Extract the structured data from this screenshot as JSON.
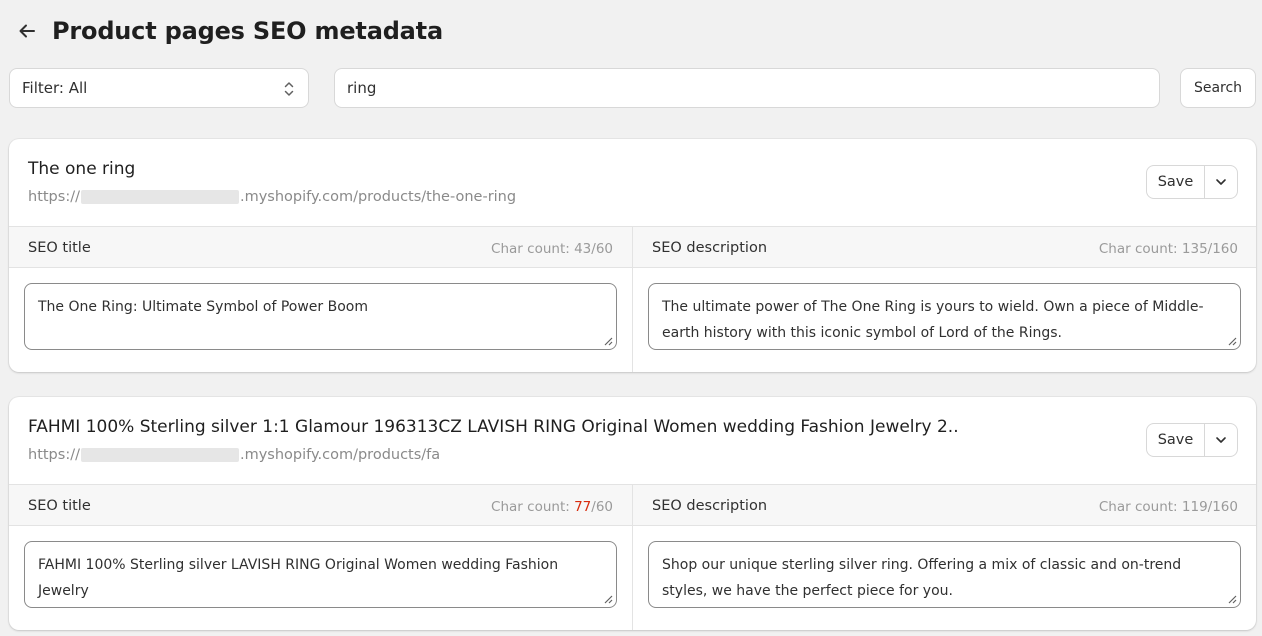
{
  "header": {
    "title": "Product pages SEO metadata",
    "back_icon": "arrow-left-icon"
  },
  "filter": {
    "label": "Filter: All"
  },
  "search": {
    "value": "ring",
    "button_label": "Search"
  },
  "products": [
    {
      "name": "The one ring",
      "url_prefix": "https://",
      "url_suffix": ".myshopify.com/products/the-one-ring",
      "save_label": "Save",
      "seo_title_label": "SEO title",
      "seo_title_count_prefix": "Char count: ",
      "seo_title_count": "43",
      "seo_title_max": "/60",
      "seo_title_value": "The One Ring: Ultimate Symbol of Power Boom",
      "seo_description_label": "SEO description",
      "seo_description_count_prefix": "Char count: ",
      "seo_description_count": "135",
      "seo_description_max": "/160",
      "seo_description_value": "The ultimate power of The One Ring is yours to wield. Own a piece of Middle-earth history with this iconic symbol of Lord of the Rings."
    },
    {
      "name": "FAHMI 100% Sterling silver 1:1 Glamour 196313CZ LAVISH RING Original Women wedding Fashion Jewelry 2..",
      "url_prefix": "https://",
      "url_suffix": ".myshopify.com/products/fa",
      "save_label": "Save",
      "seo_title_label": "SEO title",
      "seo_title_count_prefix": "Char count: ",
      "seo_title_count": "77",
      "seo_title_max": "/60",
      "seo_title_value": "FAHMI 100% Sterling silver LAVISH RING Original Women wedding Fashion Jewelry",
      "seo_description_label": "SEO description",
      "seo_description_count_prefix": "Char count: ",
      "seo_description_count": "119",
      "seo_description_max": "/160",
      "seo_description_value": "Shop our unique sterling silver ring. Offering a mix of classic and on-trend styles, we have the perfect piece for you."
    }
  ],
  "colors": {
    "background": "#f1f1f1",
    "card": "#ffffff",
    "over_limit": "#d82c0d",
    "muted_text": "#8a8a8a"
  }
}
